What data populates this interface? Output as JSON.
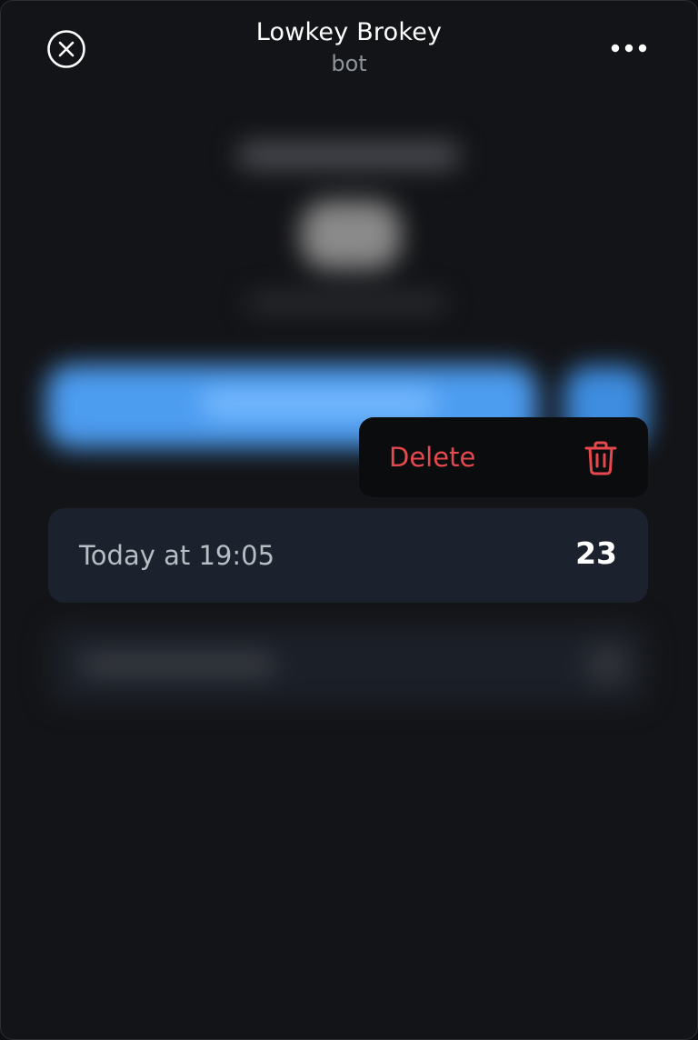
{
  "header": {
    "title": "Lowkey Brokey",
    "subtitle": "bot"
  },
  "icons": {
    "close": "close-circle-icon",
    "more": "more-horizontal-icon",
    "delete": "trash-icon"
  },
  "context_menu": {
    "delete_label": "Delete"
  },
  "focused_item": {
    "time": "Today at 19:05",
    "count": "23"
  },
  "colors": {
    "background": "#131417",
    "danger": "#e5484d",
    "accent_blue": "#4c9cf0",
    "row_background": "#1b222d",
    "menu_background": "#0b0c0e"
  }
}
